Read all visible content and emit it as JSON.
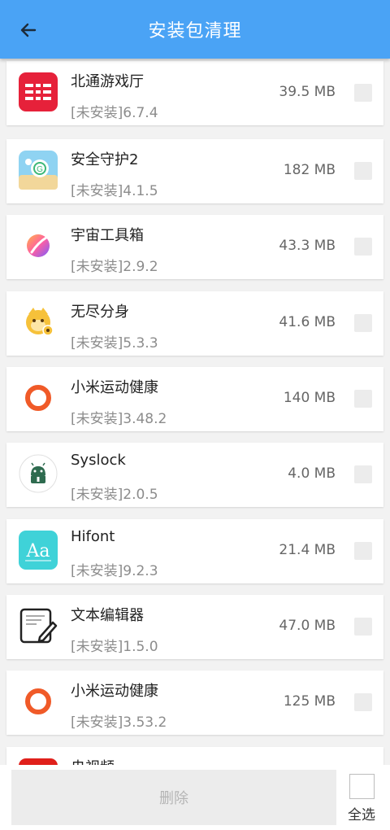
{
  "header": {
    "title": "安装包清理",
    "back_icon": "arrow-left-icon"
  },
  "apps": [
    {
      "name": "北通游戏厅",
      "version": "[未安装]6.7.4",
      "size": "39.5 MB",
      "icon": "betop-icon",
      "checked": false
    },
    {
      "name": "安全守护2",
      "version": "[未安装]4.1.5",
      "size": "182 MB",
      "icon": "security-guard-icon",
      "checked": false
    },
    {
      "name": "宇宙工具箱",
      "version": "[未安装]2.9.2",
      "size": "43.3 MB",
      "icon": "universe-toolbox-icon",
      "checked": false
    },
    {
      "name": "无尽分身",
      "version": "[未安装]5.3.3",
      "size": "41.6 MB",
      "icon": "monkey-icon",
      "checked": false
    },
    {
      "name": "小米运动健康",
      "version": "[未安装]3.48.2",
      "size": "140 MB",
      "icon": "ring-icon",
      "checked": false
    },
    {
      "name": "Syslock",
      "version": "[未安装]2.0.5",
      "size": "4.0 MB",
      "icon": "android-lock-icon",
      "checked": false
    },
    {
      "name": "Hifont",
      "version": "[未安装]9.2.3",
      "size": "21.4 MB",
      "icon": "font-aa-icon",
      "checked": false
    },
    {
      "name": "文本编辑器",
      "version": "[未安装]1.5.0",
      "size": "47.0 MB",
      "icon": "text-editor-icon",
      "checked": false
    },
    {
      "name": "小米运动健康",
      "version": "[未安装]3.53.2",
      "size": "125 MB",
      "icon": "ring-icon",
      "checked": false
    },
    {
      "name": "央视频",
      "version": "",
      "size": "",
      "icon": "cctv-video-icon",
      "checked": false
    }
  ],
  "footer": {
    "delete_label": "删除",
    "select_all_label": "全选",
    "select_all_checked": false
  },
  "colors": {
    "appbar": "#4aa3f5",
    "checkbox": "#ececec",
    "ring": "#f05a28",
    "betop": "#e6213a",
    "hifont": "#3fd2d8"
  }
}
